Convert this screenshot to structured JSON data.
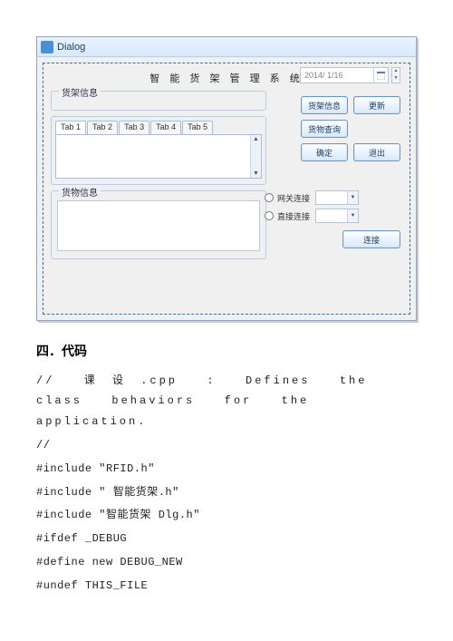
{
  "dialog": {
    "window_title": "Dialog",
    "heading": "智 能 货 架 管 理 系 统",
    "shelf_group_label": "货架信息",
    "goods_group_label": "货物信息",
    "tabs": [
      "Tab 1",
      "Tab 2",
      "Tab 3",
      "Tab 4",
      "Tab 5"
    ],
    "date_value": "2014/ 1/16",
    "buttons": {
      "shelf_info": "货架信息",
      "refresh": "更新",
      "goods_query": "货物查询",
      "confirm": "确定",
      "exit": "退出",
      "connect": "连接"
    },
    "radios": {
      "gateway": "网关连接",
      "direct": "直接连接"
    }
  },
  "doc": {
    "section_title": "四．代码",
    "lines": [
      "//  课 设 .cpp  :  Defines  the  class  behaviors  for  the application.",
      "//",
      "",
      "#include \"RFID.h\"",
      "#include \" 智能货架.h\"",
      "#include \"智能货架 Dlg.h\"",
      "",
      "#ifdef _DEBUG",
      "#define new DEBUG_NEW",
      "#undef THIS_FILE"
    ]
  }
}
